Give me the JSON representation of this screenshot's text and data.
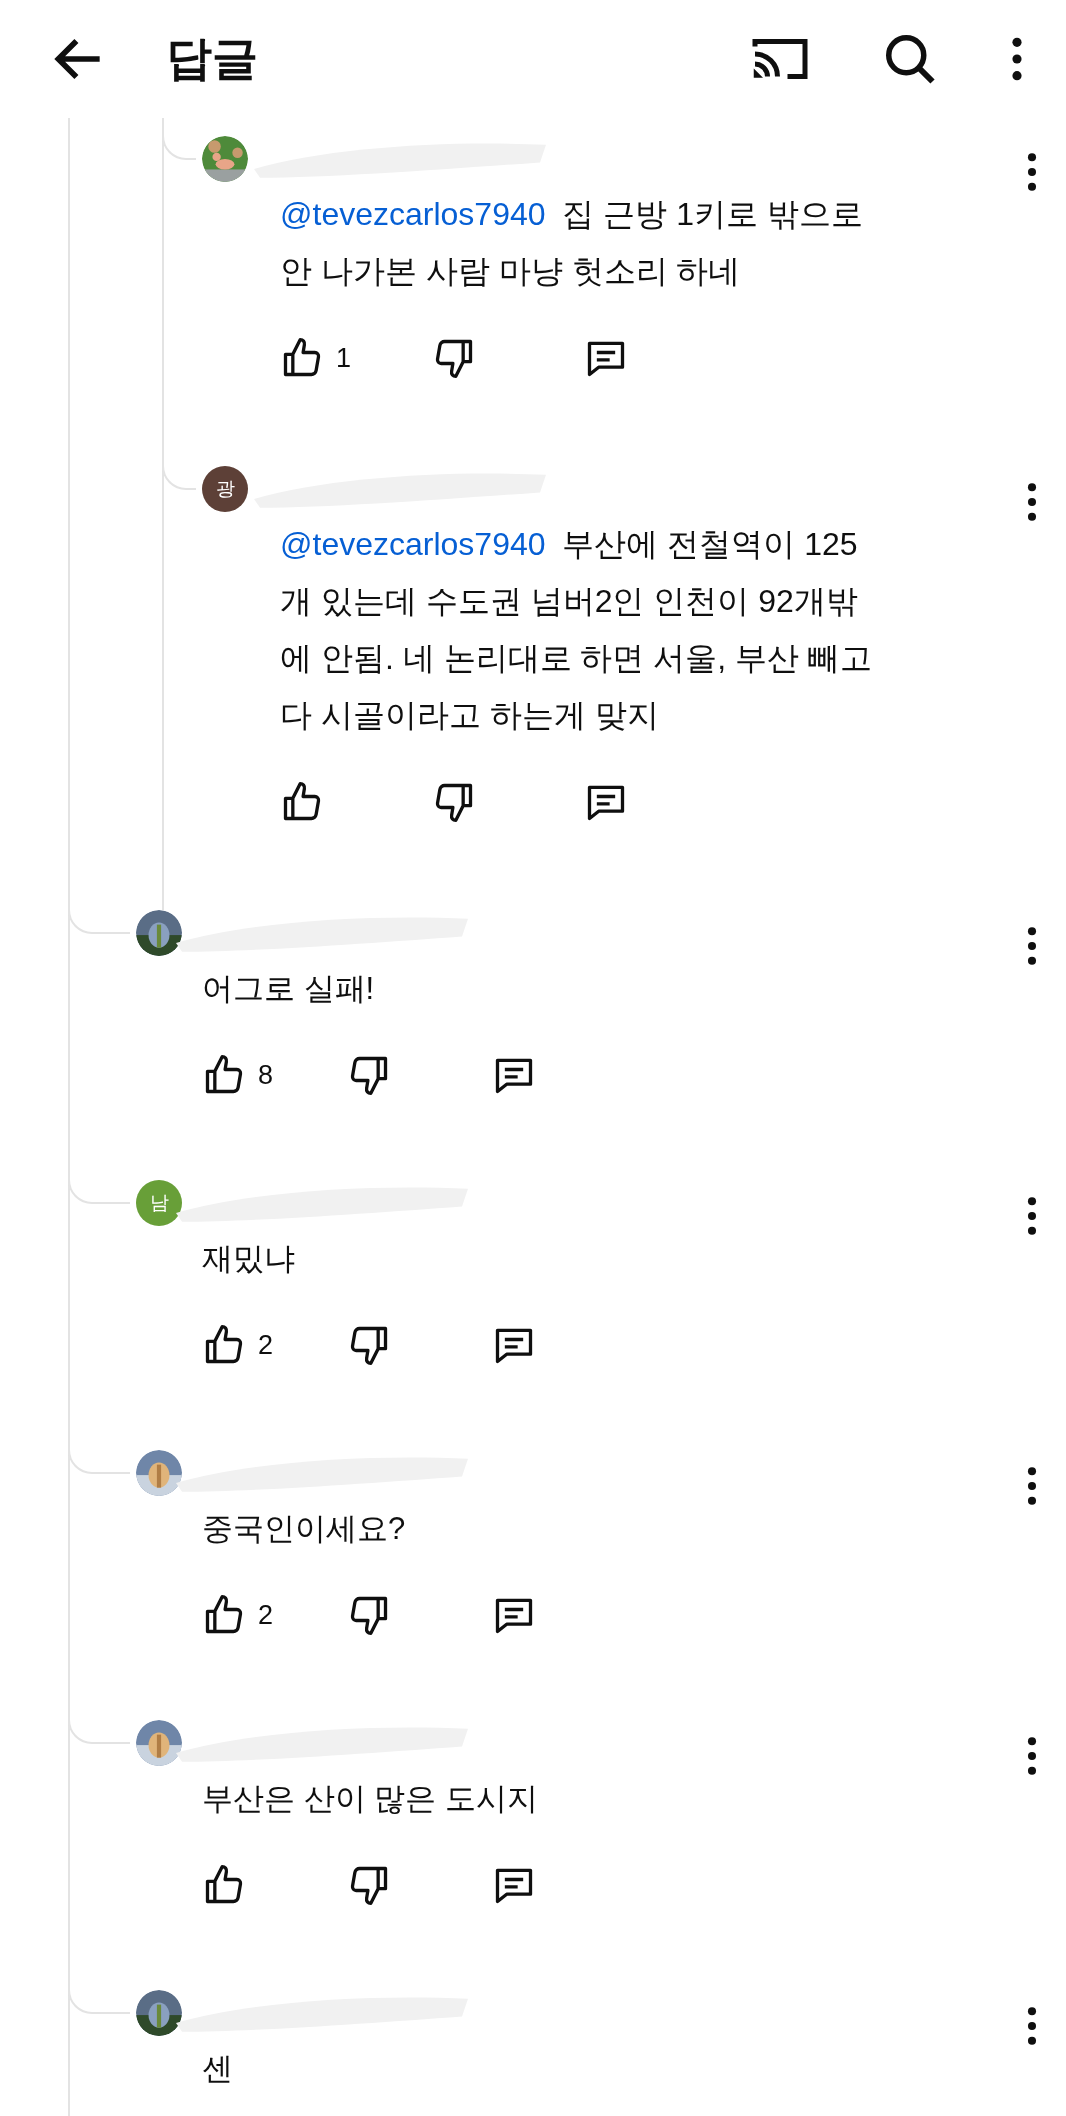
{
  "header": {
    "title": "답글"
  },
  "nested_replies": [
    {
      "mention": "@tevezcarlos7940",
      "text": "집 근방 1키로 밖으로 안 나가본 사람 마냥 헛소리 하네",
      "likes": "1"
    },
    {
      "avatar": {
        "kind": "letter",
        "letter": "광",
        "color": "#5d4037"
      },
      "mention": "@tevezcarlos7940",
      "text": "부산에 전철역이 125개 있는데 수도권 넘버2인 인천이 92개밖에 안됨. 네 논리대로 하면 서울, 부산 빼고 다 시골이라고 하는게 맞지"
    }
  ],
  "replies": [
    {
      "text": "어그로 실패!",
      "likes": "8",
      "actions_visible": true
    },
    {
      "avatar": {
        "kind": "letter",
        "letter": "남",
        "color": "#689f38"
      },
      "text": "재밌냐",
      "likes": "2",
      "actions_visible": true
    },
    {
      "text": "중국인이세요?",
      "likes": "2",
      "actions_visible": true
    },
    {
      "text": "부산은 산이 많은 도시지",
      "actions_visible": true
    },
    {
      "text": "센",
      "actions_visible": false
    }
  ]
}
